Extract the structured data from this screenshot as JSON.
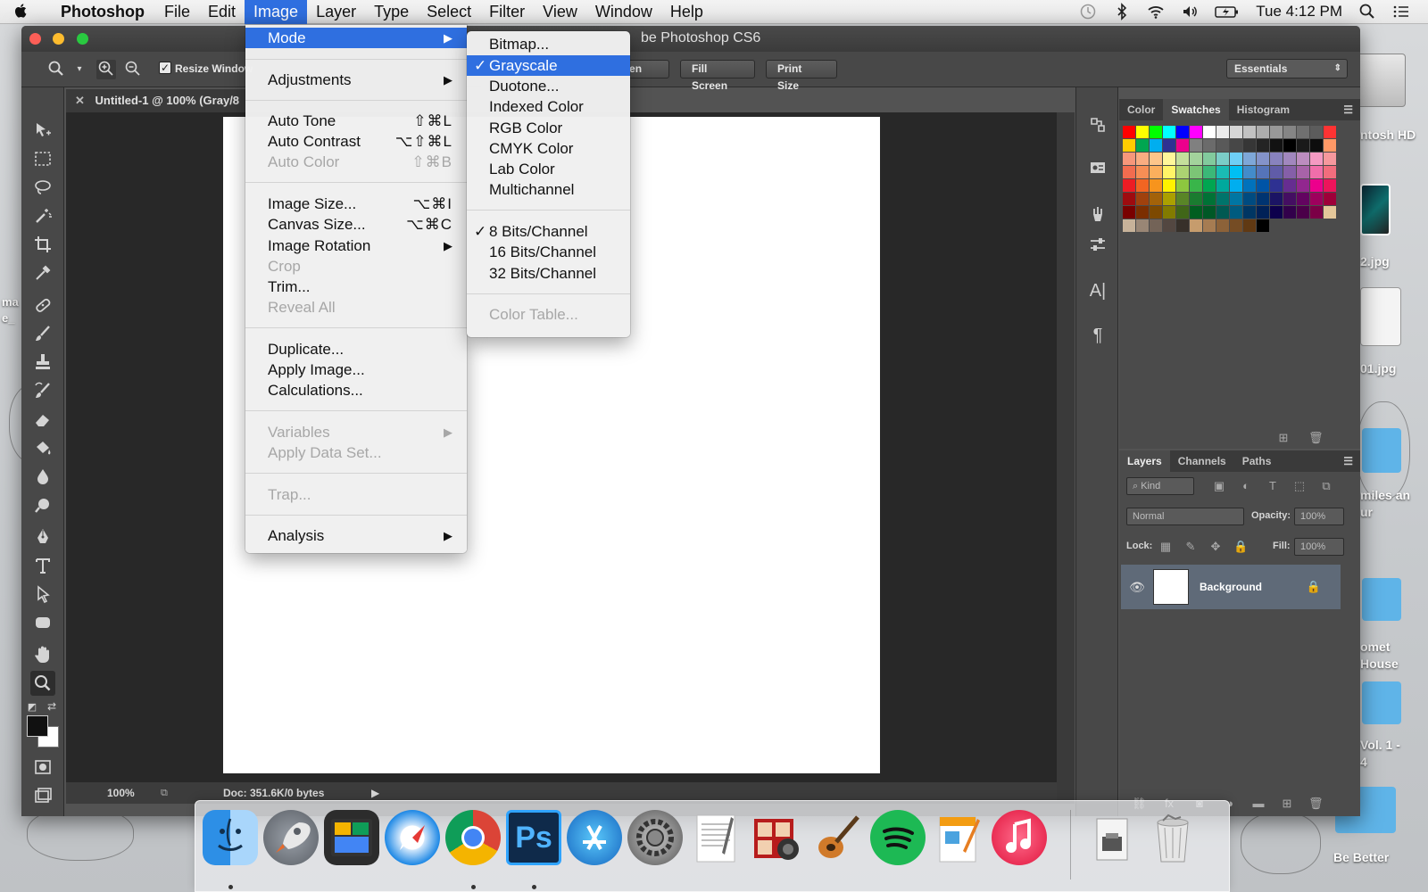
{
  "menubar": {
    "apple_icon": "apple-icon",
    "app_name": "Photoshop",
    "items": [
      "File",
      "Edit",
      "Image",
      "Layer",
      "Type",
      "Select",
      "Filter",
      "View",
      "Window",
      "Help"
    ],
    "active_item": "Image",
    "clock": "Tue 4:12 PM",
    "status_icons": [
      "time-machine-icon",
      "bluetooth-icon",
      "wifi-icon",
      "volume-icon",
      "battery-icon",
      "spotlight-search-icon",
      "notification-center-icon"
    ]
  },
  "window": {
    "title": "be Photoshop CS6",
    "options_bar": {
      "resize_windows_label": "Resize Window",
      "resize_windows_checked": true,
      "buttons": [
        "creen",
        "Fill Screen",
        "Print Size"
      ],
      "workspace": "Essentials"
    },
    "document_tab": "Untitled-1 @ 100% (Gray/8",
    "status_bar": {
      "zoom": "100%",
      "doc_info": "Doc: 351.6K/0 bytes"
    }
  },
  "image_menu": {
    "items": [
      {
        "label": "Mode",
        "submenu": true,
        "highlight": true
      },
      {
        "label": "Adjustments",
        "submenu": true
      },
      {
        "label": "Auto Tone",
        "shortcut": "⇧⌘L"
      },
      {
        "label": "Auto Contrast",
        "shortcut": "⌥⇧⌘L"
      },
      {
        "label": "Auto Color",
        "shortcut": "⇧⌘B",
        "disabled": true
      },
      {
        "label": "Image Size...",
        "shortcut": "⌥⌘I"
      },
      {
        "label": "Canvas Size...",
        "shortcut": "⌥⌘C"
      },
      {
        "label": "Image Rotation",
        "submenu": true
      },
      {
        "label": "Crop",
        "disabled": true
      },
      {
        "label": "Trim..."
      },
      {
        "label": "Reveal All",
        "disabled": true
      },
      {
        "label": "Duplicate..."
      },
      {
        "label": "Apply Image..."
      },
      {
        "label": "Calculations..."
      },
      {
        "label": "Variables",
        "submenu": true,
        "disabled": true
      },
      {
        "label": "Apply Data Set...",
        "disabled": true
      },
      {
        "label": "Trap...",
        "disabled": true
      },
      {
        "label": "Analysis",
        "submenu": true
      }
    ]
  },
  "mode_submenu": {
    "items": [
      {
        "label": "Bitmap..."
      },
      {
        "label": "Grayscale",
        "checked": true,
        "highlight": true
      },
      {
        "label": "Duotone..."
      },
      {
        "label": "Indexed Color"
      },
      {
        "label": "RGB Color"
      },
      {
        "label": "CMYK Color"
      },
      {
        "label": "Lab Color"
      },
      {
        "label": "Multichannel"
      },
      {
        "label": "8 Bits/Channel",
        "checked": true
      },
      {
        "label": "16 Bits/Channel"
      },
      {
        "label": "32 Bits/Channel"
      },
      {
        "label": "Color Table...",
        "disabled": true
      }
    ],
    "check_mark": "✓"
  },
  "swatches_panel": {
    "tabs": [
      "Color",
      "Swatches",
      "Histogram"
    ],
    "active_tab": "Swatches",
    "colors": [
      "#ff0000",
      "#ffff00",
      "#00ff00",
      "#00ffff",
      "#0000ff",
      "#ff00ff",
      "#ffffff",
      "#ebebeb",
      "#d6d6d6",
      "#c2c2c2",
      "#adadad",
      "#999999",
      "#858585",
      "#707070",
      "#5c5c5c",
      "#ff3333",
      "#ffcc00",
      "#00a650",
      "#00aeef",
      "#2e3192",
      "#ec008c",
      "#808080",
      "#6b6b6b",
      "#595959",
      "#474747",
      "#363636",
      "#242424",
      "#121212",
      "#000000",
      "#1a1a1a",
      "#0d0d0d",
      "#ff9966",
      "#f7977a",
      "#f9ad81",
      "#fdc68a",
      "#fff79a",
      "#c4df9b",
      "#a3d39c",
      "#82ca9d",
      "#7bcdc8",
      "#6ecff6",
      "#7ea7d8",
      "#8493ca",
      "#8882be",
      "#a187be",
      "#bc8dbf",
      "#f49ac2",
      "#f6989d",
      "#f26c4f",
      "#f68e55",
      "#fbaf5d",
      "#fff467",
      "#acd372",
      "#7cc576",
      "#3bb878",
      "#1abbb4",
      "#00bff3",
      "#438cca",
      "#5574b9",
      "#605ca8",
      "#855fa8",
      "#a763a8",
      "#f06eaa",
      "#f26d7d",
      "#ed1c24",
      "#f26522",
      "#f7941d",
      "#fff200",
      "#8dc73f",
      "#39b54a",
      "#00a651",
      "#00a99d",
      "#00aeef",
      "#0072bc",
      "#0054a6",
      "#2e3192",
      "#662d91",
      "#92278f",
      "#ec008c",
      "#ed145b",
      "#9e0b0f",
      "#a0410d",
      "#a36209",
      "#aba000",
      "#598527",
      "#1a7b30",
      "#007236",
      "#00746b",
      "#0076a3",
      "#004b80",
      "#003471",
      "#1b1464",
      "#440e62",
      "#630460",
      "#9e005d",
      "#9e0039",
      "#790000",
      "#7b2e00",
      "#7d4900",
      "#827b00",
      "#406618",
      "#005e20",
      "#005826",
      "#005952",
      "#005b7f",
      "#003663",
      "#002157",
      "#0d004c",
      "#32004b",
      "#4b0049",
      "#7b0046",
      "#e4c79a",
      "#c7b299",
      "#998675",
      "#736357",
      "#534741",
      "#37302a",
      "#c69c6d",
      "#a67c52",
      "#8c6239",
      "#754c24",
      "#603913",
      "#000000"
    ]
  },
  "layers_panel": {
    "tabs": [
      "Layers",
      "Channels",
      "Paths"
    ],
    "active_tab": "Layers",
    "filter_label": "Kind",
    "blend_mode": "Normal",
    "opacity_label": "Opacity:",
    "opacity_value": "100%",
    "lock_label": "Lock:",
    "fill_label": "Fill:",
    "fill_value": "100%",
    "layer_name": "Background"
  },
  "desktop": {
    "labels": [
      "ntosh HD",
      "2.jpg",
      "01.jpg",
      "ma\ne_",
      "miles an\nur",
      "omet\n House",
      "Vol. 1 -\n4",
      "Be Better"
    ]
  },
  "dock": {
    "apps": [
      "Finder",
      "Launchpad",
      "Dashboard",
      "Safari",
      "Chrome",
      "Photoshop",
      "App Store",
      "System Preferences",
      "TextEdit",
      "Photo Booth",
      "GarageBand",
      "Spotify",
      "Pages",
      "iTunes",
      "Downloads",
      "Trash"
    ],
    "ps_label": "Ps"
  }
}
